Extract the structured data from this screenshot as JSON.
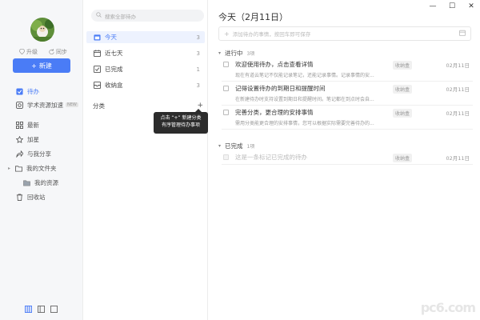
{
  "sidebar": {
    "upgrade": "升级",
    "sync": "同步",
    "new_button": "新建",
    "items": [
      {
        "label": "待办",
        "icon": "checkbox-icon",
        "active": true
      },
      {
        "label": "学术资源加速",
        "icon": "globe-icon",
        "badge": "NEW"
      },
      {
        "label": "最新",
        "icon": "grid-icon"
      },
      {
        "label": "加星",
        "icon": "star-icon"
      },
      {
        "label": "与我分享",
        "icon": "share-icon"
      },
      {
        "label": "我的文件夹",
        "icon": "folder-icon"
      },
      {
        "label": "我的资源",
        "icon": "folder-icon"
      },
      {
        "label": "回收站",
        "icon": "trash-icon"
      }
    ]
  },
  "midlist": {
    "search_placeholder": "搜索全部待办",
    "items": [
      {
        "label": "今天",
        "count": "3",
        "icon": "calendar-icon",
        "active": true
      },
      {
        "label": "近七天",
        "count": "3",
        "icon": "calendar-week-icon"
      },
      {
        "label": "已完成",
        "count": "1",
        "icon": "check-square-icon"
      },
      {
        "label": "收纳盒",
        "count": "3",
        "icon": "inbox-icon"
      }
    ],
    "category_label": "分类",
    "category_add": "+",
    "tooltip_line1": "点击 “+” 新建分类",
    "tooltip_line2": "有序管理待办事项"
  },
  "main": {
    "title": "今天（2月11日）",
    "add_placeholder": "添加待办的事情，按回车即可保存",
    "in_progress_label": "进行中",
    "in_progress_count": "3项",
    "done_label": "已完成",
    "done_count": "1项",
    "tasks": [
      {
        "title": "欢迎使用待办，点击查看详情",
        "desc": "现在有道云笔记不仅能记录笔记，还能记录事情。记录事情的安...",
        "tag": "收纳盒",
        "date": "02月11日"
      },
      {
        "title": "记得设置待办的到期日和提醒时间",
        "desc": "在新建待办时支持设置到期日和提醒时间。笔记都在到点时会自...",
        "tag": "收纳盒",
        "date": "02月11日"
      },
      {
        "title": "完善分类，更合理的安排事情",
        "desc": "需用分类能更合理的安排事情，您可以根据实际需要完善待办的...",
        "tag": "收纳盒",
        "date": "02月11日"
      }
    ],
    "done_tasks": [
      {
        "title": "这是一条标记已完成的待办",
        "tag": "收纳盒",
        "date": "02月11日"
      }
    ]
  },
  "window": {
    "minimize": "—",
    "maximize": "☐",
    "close": "✕"
  },
  "watermark": "pc6.com"
}
